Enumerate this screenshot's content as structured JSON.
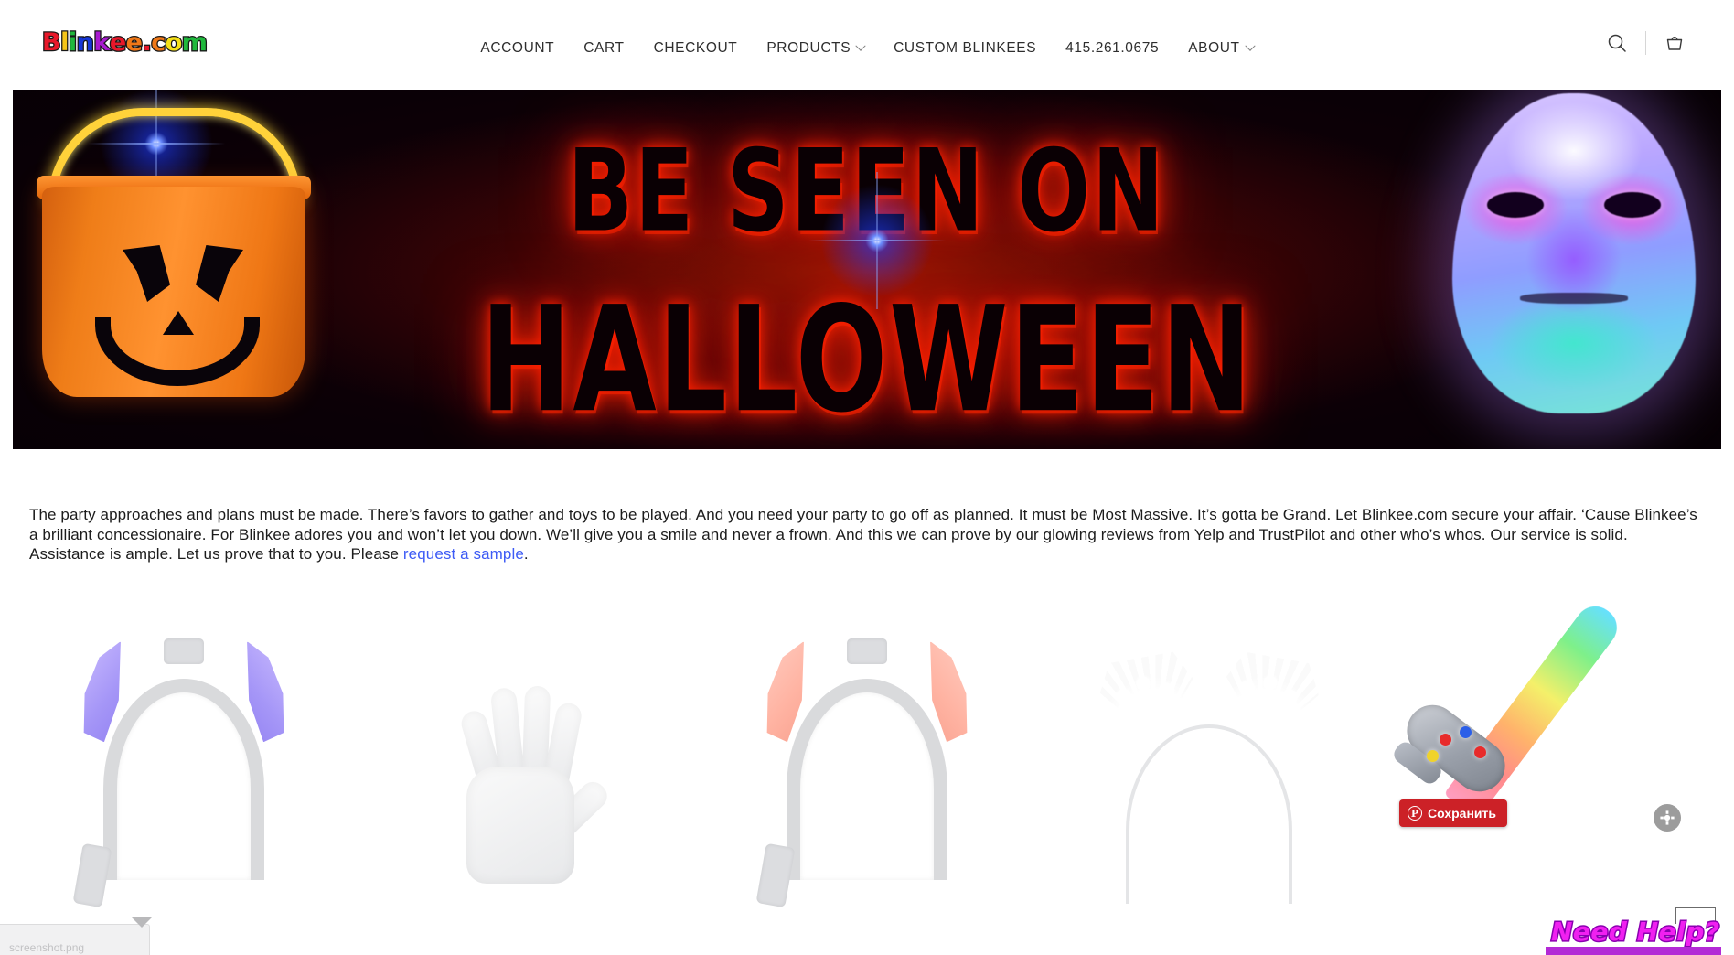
{
  "header": {
    "logo": {
      "name": "Blinkee.com",
      "letters": [
        {
          "ch": "B",
          "color": "#e8182a"
        },
        {
          "ch": "l",
          "color": "#f5c518"
        },
        {
          "ch": "i",
          "color": "#1fb83c"
        },
        {
          "ch": "n",
          "color": "#1636d8"
        },
        {
          "ch": "k",
          "color": "#a81ad0"
        },
        {
          "ch": "e",
          "color": "#e8182a"
        },
        {
          "ch": "e",
          "color": "#f07818"
        },
        {
          "ch": ".",
          "color": "#e8182a"
        },
        {
          "ch": "c",
          "color": "#f07818"
        },
        {
          "ch": "o",
          "color": "#f5e018"
        },
        {
          "ch": "m",
          "color": "#1fb83c"
        }
      ]
    },
    "nav": [
      {
        "label": "ACCOUNT",
        "has_dropdown": false
      },
      {
        "label": "CART",
        "has_dropdown": false
      },
      {
        "label": "CHECKOUT",
        "has_dropdown": false
      },
      {
        "label": "PRODUCTS",
        "has_dropdown": true
      },
      {
        "label": "CUSTOM BLINKEES",
        "has_dropdown": false
      },
      {
        "label": "415.261.0675",
        "has_dropdown": false
      },
      {
        "label": "ABOUT",
        "has_dropdown": true
      }
    ],
    "actions": {
      "search_icon": "search-icon",
      "cart_icon": "shopping-basket-icon"
    }
  },
  "banner": {
    "title_line1": "BE SEEN ON",
    "title_line2": "HALLOWEEN",
    "left_product": "light-up-jack-o-lantern-bucket",
    "right_product": "led-light-up-glowing-face-mask"
  },
  "intro": {
    "text_before_link": "The party approaches and plans must be made. There’s favors to gather and toys to be played. And you need your party to go off as planned. It must be Most Massive. It’s gotta be Grand. Let Blinkee.com secure your affair. ‘Cause Blinkee’s a brilliant concessionaire. For Blinkee adores you and won’t let you down. We’ll give you a smile and never a frown. And this we can prove by our glowing reviews from Yelp and TrustPilot and other who’s whos. Our service is solid. Assistance is ample. Let us prove that to you. Please ",
    "link_text": "request a sample",
    "text_after_link": "."
  },
  "products": [
    {
      "name": "light-up-devil-horns-headband-purple",
      "type": "horns",
      "horn_color": "#a596f7"
    },
    {
      "name": "light-up-sequin-glove-white",
      "type": "glove"
    },
    {
      "name": "light-up-devil-horns-headband-pink",
      "type": "horns",
      "horn_color": "#ffb3a2"
    },
    {
      "name": "light-up-lace-cat-ears-headband-white",
      "type": "lace-ears"
    },
    {
      "name": "light-up-rainbow-led-sword",
      "type": "sword"
    }
  ],
  "overlays": {
    "pinterest_save_label": "Сохранить",
    "pinterest_icon": "pinterest-icon",
    "expand_icon": "expand-move-icon",
    "need_help_label": "Need Help?",
    "download_item_label": "screenshot.png"
  },
  "colors": {
    "pinterest_red": "#cc2127",
    "link_blue": "#3d5bf5",
    "need_help_magenta": "#f020f0",
    "need_help_purple": "#b32ad6",
    "banner_red_glow": "#ff2800"
  }
}
